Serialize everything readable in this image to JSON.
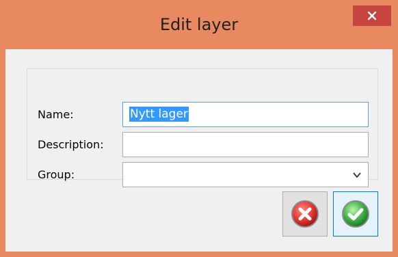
{
  "window": {
    "title": "Edit layer"
  },
  "form": {
    "name_label": "Name:",
    "name_value": "Nytt lager",
    "description_label": "Description:",
    "description_value": "",
    "group_label": "Group:",
    "group_value": ""
  },
  "buttons": {
    "cancel_icon": "red-x-circle-icon",
    "ok_icon": "green-check-circle-icon"
  },
  "colors": {
    "window_frame": "#e8895f",
    "close_button": "#c7453f",
    "selection": "#3399ff",
    "focus_border": "#569de5"
  }
}
